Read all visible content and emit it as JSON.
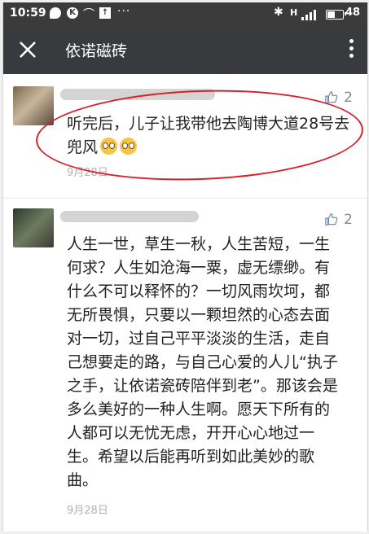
{
  "status_bar": {
    "time": "10:59",
    "icons": [
      "message-icon",
      "k-app-icon",
      "signal-hook-icon",
      "upload-icon",
      "more-icon",
      "bluetooth-icon",
      "network-icon",
      "signal-bars-icon",
      "battery-icon"
    ],
    "network": "H",
    "battery": "48"
  },
  "header": {
    "title": "依诺磁砖",
    "close_icon": "close-icon",
    "menu_icon": "more-vertical-icon"
  },
  "comments": [
    {
      "likes": "2",
      "text": "听完后，儿子让我带他去陶博大道28号去兜风",
      "emoji_count": 2,
      "date": "9月28日",
      "highlighted": true,
      "highlight_color": "#d7202a"
    },
    {
      "likes": "2",
      "lines": [
        "人生一世，草生一秋，人生苦短，一生",
        "何求？人生如沧海一粟，虚无缥缈。有",
        "什么不可以释怀的？一切风雨坎坷，都",
        "无所畏惧，只要以一颗坦然的心态去面",
        "对一切，过自己平平淡淡的生活，走自",
        "己想要走的路，与自己心爱的人儿“执子",
        "之手，让依诺瓷砖陪伴到老”。那该会是",
        "多么美好的一种人生啊。愿天下所有的",
        "人都可以无忧无虑，开开心心地过一",
        "生。希望以后能再听到如此美妙的歌",
        "曲。"
      ],
      "date": "9月28日"
    }
  ],
  "colors": {
    "title_bar": "#393a3e",
    "status_bar": "#3b3b3b",
    "text": "#222222",
    "meta": "#b2b2b2"
  }
}
